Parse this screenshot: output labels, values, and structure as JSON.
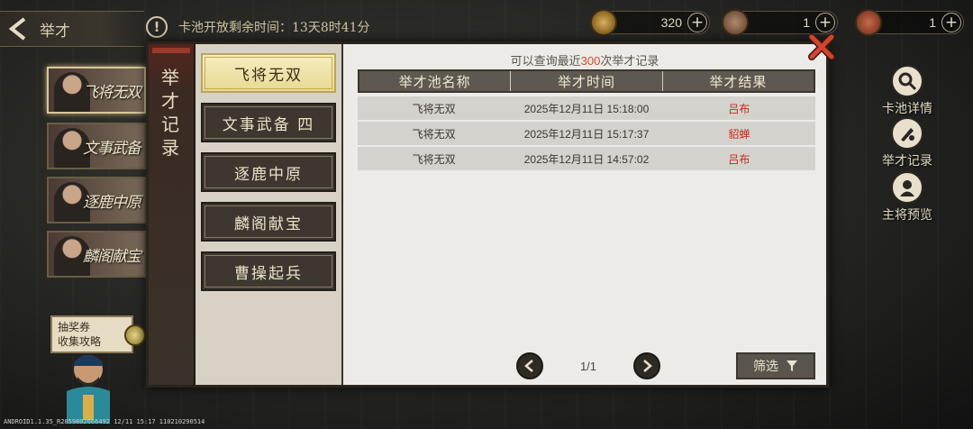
{
  "header": {
    "back_title": "举才",
    "notice_text": "卡池开放剩余时间：13天8时41分"
  },
  "currencies": [
    {
      "value": "320",
      "icon": "coin-icon"
    },
    {
      "value": "1",
      "icon": "token-icon"
    },
    {
      "value": "1",
      "icon": "ticket-icon"
    }
  ],
  "banners": [
    {
      "label": "飞将无双"
    },
    {
      "label": "文事武备"
    },
    {
      "label": "逐鹿中原"
    },
    {
      "label": "麟阁献宝"
    }
  ],
  "guide": {
    "line1": "抽奖券",
    "line2": "收集攻略"
  },
  "right_menu": [
    {
      "label": "卡池详情",
      "icon": "magnifier-icon"
    },
    {
      "label": "举才记录",
      "icon": "brush-icon"
    },
    {
      "label": "主将预览",
      "icon": "general-icon"
    }
  ],
  "modal": {
    "side_title": "举才记录",
    "tabs": [
      {
        "label": "飞将无双",
        "selected": true
      },
      {
        "label": "文事武备 四",
        "selected": false
      },
      {
        "label": "逐鹿中原",
        "selected": false
      },
      {
        "label": "麟阁献宝",
        "selected": false
      },
      {
        "label": "曹操起兵",
        "selected": false
      }
    ],
    "hint_pre": "可以查询最近",
    "hint_num": "300",
    "hint_post": "次举才记录",
    "columns": [
      "举才池名称",
      "举才时间",
      "举才结果"
    ],
    "rows": [
      {
        "pool": "飞将无双",
        "time": "2025年12月11日 15:18:00",
        "result": "吕布"
      },
      {
        "pool": "飞将无双",
        "time": "2025年12月11日 15:17:37",
        "result": "貂蝉"
      },
      {
        "pool": "飞将无双",
        "time": "2025年12月11日 14:57:02",
        "result": "吕布"
      }
    ],
    "page": "1/1",
    "filter_label": "筛选"
  },
  "footer_text": "ANDROID1.1.35_R2859802666492 12/11 15:17 110210290514",
  "colors": {
    "accent_red": "#c8281e",
    "hint_number": "#d14a2a",
    "selected_tab": "#f6edbe"
  }
}
